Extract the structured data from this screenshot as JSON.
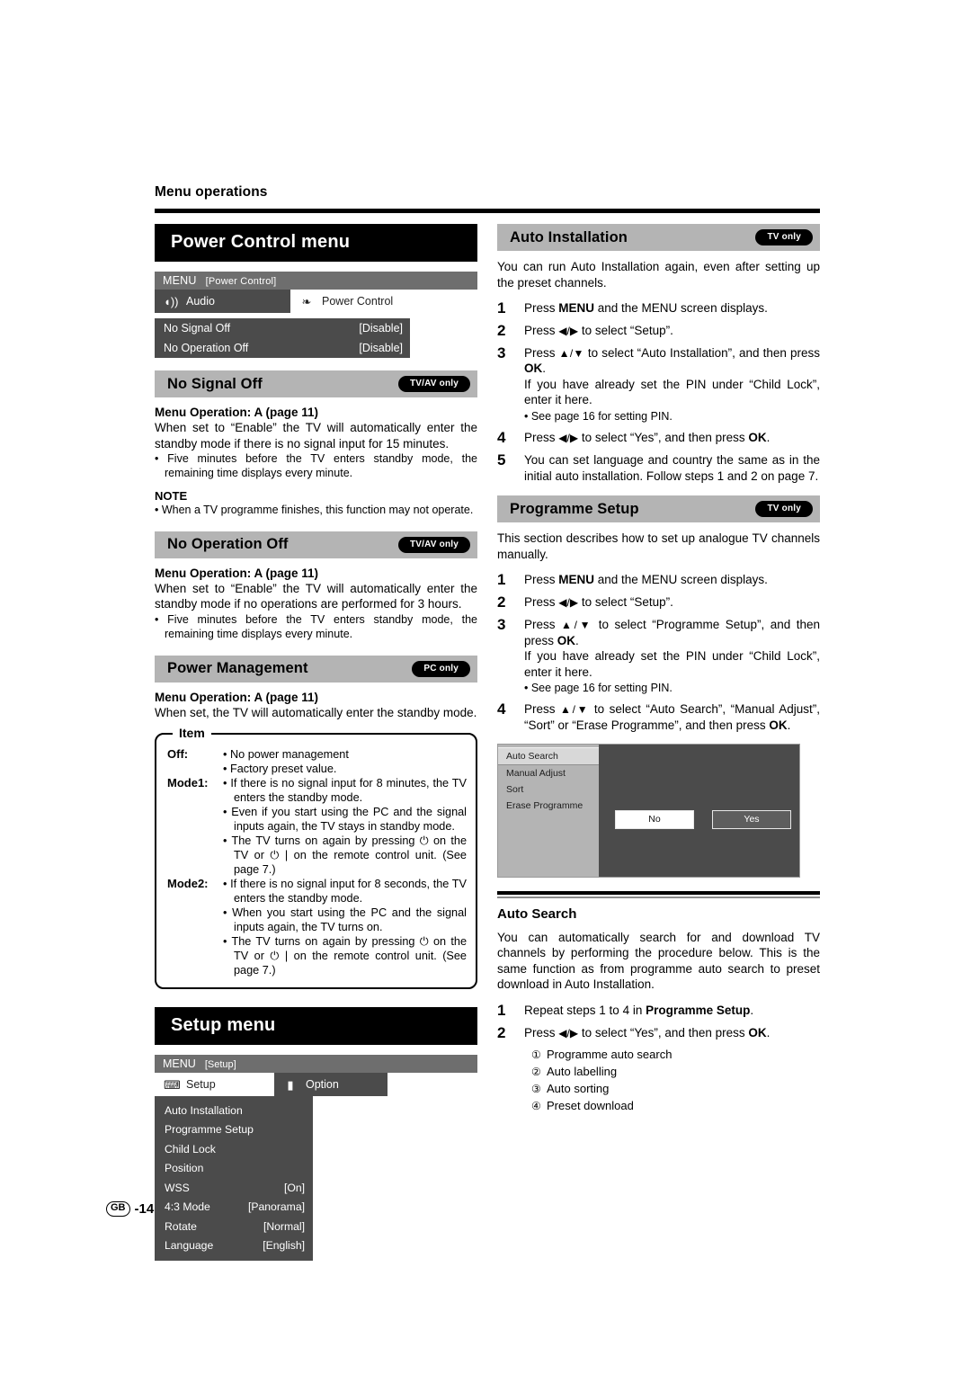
{
  "running_head": "Menu operations",
  "footer": {
    "region": "GB",
    "page": "-14"
  },
  "left": {
    "power_control_menu": {
      "bar_title": "Power Control menu",
      "osd": {
        "titlebar_label": "MENU",
        "titlebar_context": "[Power Control]",
        "tabs": [
          {
            "label": "Audio",
            "icon": "speaker-icon",
            "active": false
          },
          {
            "label": "Power Control",
            "icon": "leaf-icon",
            "active": true
          }
        ],
        "rows": [
          {
            "label": "No Signal Off",
            "value": "[Disable]"
          },
          {
            "label": "No Operation Off",
            "value": "[Disable]"
          }
        ]
      }
    },
    "no_signal_off": {
      "title": "No Signal Off",
      "pill": "TV/AV only",
      "menu_operation": "Menu Operation: A (page 11)",
      "body": "When set to “Enable” the TV will automatically enter the standby mode if there is no signal input for 15 minutes.",
      "bullet": "• Five minutes before the TV enters standby mode, the remaining time displays every minute.",
      "note_head": "NOTE",
      "note_bullet": "• When a TV programme finishes, this function may not operate."
    },
    "no_operation_off": {
      "title": "No Operation Off",
      "pill": "TV/AV only",
      "menu_operation": "Menu Operation: A (page 11)",
      "body": "When set to “Enable” the TV will automatically enter the standby mode if no operations are performed for 3 hours.",
      "bullet": "• Five minutes before the TV enters standby mode, the remaining time displays every minute."
    },
    "power_management": {
      "title": "Power Management",
      "pill": "PC only",
      "menu_operation": "Menu Operation: A (page 11)",
      "body": "When set, the TV will automatically enter the standby mode.",
      "item_box": {
        "legend": "Item",
        "rows": [
          {
            "label": "Off:",
            "bullets": [
              "• No power management",
              "• Factory preset value."
            ]
          },
          {
            "label": "Mode1:",
            "bullets": [
              "• If there is no signal input for 8 minutes, the TV enters the standby mode.",
              "• Even if you start using the PC and the signal inputs again, the TV stays in standby mode.",
              "• The TV turns on again by pressing ⏻ on the TV or ⏻ | on the remote control unit. (See page 7.)"
            ]
          },
          {
            "label": "Mode2:",
            "bullets": [
              "• If there is no signal input for 8 seconds, the TV enters the standby mode.",
              "• When you start using the PC and the signal inputs again, the TV turns on.",
              "• The TV turns on again by pressing ⏻ on the TV or ⏻ | on the remote control unit. (See page 7.)"
            ]
          }
        ]
      }
    },
    "setup_menu": {
      "bar_title": "Setup menu",
      "osd": {
        "titlebar_label": "MENU",
        "titlebar_context": "[Setup]",
        "tabs": [
          {
            "label": "Setup",
            "icon": "setup-icon",
            "active": true
          },
          {
            "label": "Option",
            "icon": "option-icon",
            "active": false
          }
        ],
        "items": [
          {
            "label": "Auto Installation",
            "value": ""
          },
          {
            "label": "Programme Setup",
            "value": ""
          },
          {
            "label": "Child Lock",
            "value": ""
          },
          {
            "label": "Position",
            "value": ""
          },
          {
            "label": "WSS",
            "value": "[On]"
          },
          {
            "label": "4:3 Mode",
            "value": "[Panorama]"
          },
          {
            "label": "Rotate",
            "value": "[Normal]"
          },
          {
            "label": "Language",
            "value": "[English]"
          }
        ]
      }
    }
  },
  "right": {
    "auto_installation": {
      "title": "Auto Installation",
      "pill": "TV only",
      "intro": "You can run Auto Installation again, even after setting up the preset channels.",
      "steps": [
        {
          "num": "1",
          "text": "Press MENU and the MENU screen displays."
        },
        {
          "num": "2",
          "text": "Press ◀/▶ to select “Setup”."
        },
        {
          "num": "3",
          "text": "Press ▲/▼ to select “Auto Installation”, and then press OK. If you have already set the PIN under “Child Lock”, enter it here.",
          "sub": "• See page 16 for setting PIN."
        },
        {
          "num": "4",
          "text": "Press ◀/▶ to select “Yes”, and then press OK."
        },
        {
          "num": "5",
          "text": "You can set language and country the same as in the initial auto installation. Follow steps 1 and 2 on page 7."
        }
      ]
    },
    "programme_setup": {
      "title": "Programme Setup",
      "pill": "TV only",
      "intro": "This section describes how to set up analogue TV channels manually.",
      "steps": [
        {
          "num": "1",
          "text": "Press MENU and the MENU screen displays."
        },
        {
          "num": "2",
          "text": "Press ◀/▶ to select “Setup”."
        },
        {
          "num": "3",
          "text": "Press ▲/▼ to select “Programme Setup”, and then press OK. If you have already set the PIN under “Child Lock”, enter it here.",
          "sub": "• See page 16 for setting PIN."
        },
        {
          "num": "4",
          "text": "Press ▲/▼ to select “Auto Search”, “Manual Adjust”, “Sort” or “Erase Programme”, and then press OK."
        }
      ],
      "osd": {
        "items": [
          {
            "label": "Auto Search",
            "selected": true
          },
          {
            "label": "Manual Adjust",
            "selected": false
          },
          {
            "label": "Sort",
            "selected": false
          },
          {
            "label": "Erase Programme",
            "selected": false
          }
        ],
        "buttons": [
          {
            "label": "No",
            "style": "light"
          },
          {
            "label": "Yes",
            "style": "dark"
          }
        ]
      }
    },
    "auto_search": {
      "title": "Auto Search",
      "intro": "You can automatically search for and download TV channels  by performing the procedure below. This is the same function as from programme auto search to preset download in Auto Installation.",
      "steps": [
        {
          "num": "1",
          "text": "Repeat steps 1 to 4 in Programme Setup."
        },
        {
          "num": "2",
          "text": "Press ◀/▶ to select “Yes”, and then press OK."
        }
      ],
      "circled_list": [
        {
          "num": "①",
          "label": "Programme auto search"
        },
        {
          "num": "②",
          "label": "Auto labelling"
        },
        {
          "num": "③",
          "label": "Auto sorting"
        },
        {
          "num": "④",
          "label": "Preset download"
        }
      ]
    }
  }
}
